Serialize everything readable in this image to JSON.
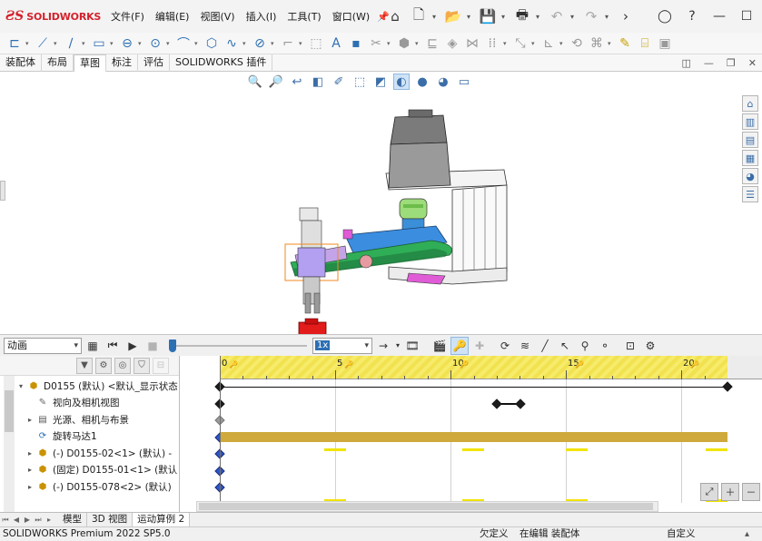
{
  "app": {
    "brand": "SOLIDWORKS",
    "brand_color": "#d4212c"
  },
  "menu": [
    "文件(F)",
    "编辑(E)",
    "视图(V)",
    "插入(I)",
    "工具(T)",
    "窗口(W)"
  ],
  "quick_access_icons": [
    "home-icon",
    "new-icon",
    "open-icon",
    "save-icon",
    "print-icon",
    "undo-icon",
    "redo-icon",
    "more-icon"
  ],
  "window_controls": [
    "user-icon",
    "help-icon",
    "minimize-icon",
    "restore-icon"
  ],
  "command_tabs": [
    {
      "label": "装配体",
      "active": false
    },
    {
      "label": "布局",
      "active": false
    },
    {
      "label": "草图",
      "active": true
    },
    {
      "label": "标注",
      "active": false
    },
    {
      "label": "评估",
      "active": false
    },
    {
      "label": "SOLIDWORKS 插件",
      "active": false
    }
  ],
  "motion": {
    "study_type": "动画",
    "speed": "1x",
    "slider_position": 0,
    "timeline_ticks": [
      {
        "value": 0,
        "label": "0"
      },
      {
        "value": 5,
        "label": "5"
      },
      {
        "value": 10,
        "label": "10"
      },
      {
        "value": 15,
        "label": "15"
      },
      {
        "value": 20,
        "label": "20"
      }
    ],
    "timeline_range": [
      0,
      22
    ],
    "tree": [
      {
        "label": "D0155 (默认) <默认_显示状态",
        "expanded": true,
        "level": 0
      },
      {
        "label": "视向及相机视图",
        "expanded": false,
        "level": 1
      },
      {
        "label": "光源、相机与布景",
        "expanded": false,
        "level": 1
      },
      {
        "label": "旋转马达1",
        "expanded": false,
        "level": 1
      },
      {
        "label": "(-) D0155-02<1> (默认) -",
        "expanded": false,
        "level": 1
      },
      {
        "label": "(固定) D0155-01<1> (默认",
        "expanded": false,
        "level": 1
      },
      {
        "label": "(-) D0155-078<2> (默认)",
        "expanded": false,
        "level": 1
      }
    ]
  },
  "bottom_tabs": [
    {
      "label": "模型",
      "active": false
    },
    {
      "label": "3D 视图",
      "active": false
    },
    {
      "label": "运动算例 2",
      "active": true
    }
  ],
  "status": {
    "product": "SOLIDWORKS Premium 2022 SP5.0",
    "definition": "欠定义",
    "mode": "在编辑 装配体",
    "custom": "自定义"
  }
}
